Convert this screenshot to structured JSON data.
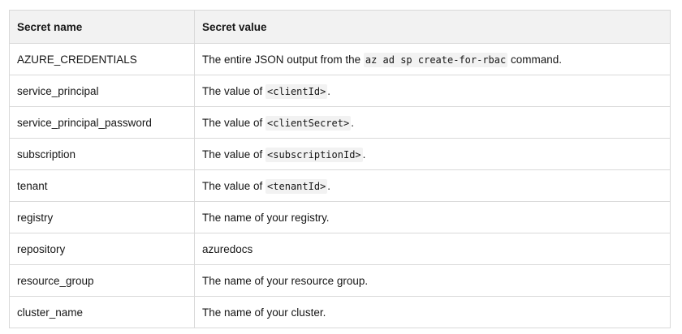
{
  "table": {
    "headers": [
      "Secret name",
      "Secret value"
    ],
    "rows": [
      {
        "name": "AZURE_CREDENTIALS",
        "pre": "The entire JSON output from the ",
        "code": "az ad sp create-for-rbac",
        "post": " command."
      },
      {
        "name": "service_principal",
        "pre": "The value of ",
        "code": "<clientId>",
        "post": "."
      },
      {
        "name": "service_principal_password",
        "pre": "The value of ",
        "code": "<clientSecret>",
        "post": "."
      },
      {
        "name": "subscription",
        "pre": "The value of ",
        "code": "<subscriptionId>",
        "post": "."
      },
      {
        "name": "tenant",
        "pre": "The value of ",
        "code": "<tenantId>",
        "post": "."
      },
      {
        "name": "registry",
        "pre": "The name of your registry.",
        "code": "",
        "post": ""
      },
      {
        "name": "repository",
        "pre": "azuredocs",
        "code": "",
        "post": ""
      },
      {
        "name": "resource_group",
        "pre": "The name of your resource group.",
        "code": "",
        "post": ""
      },
      {
        "name": "cluster_name",
        "pre": "The name of your cluster.",
        "code": "",
        "post": ""
      }
    ]
  }
}
